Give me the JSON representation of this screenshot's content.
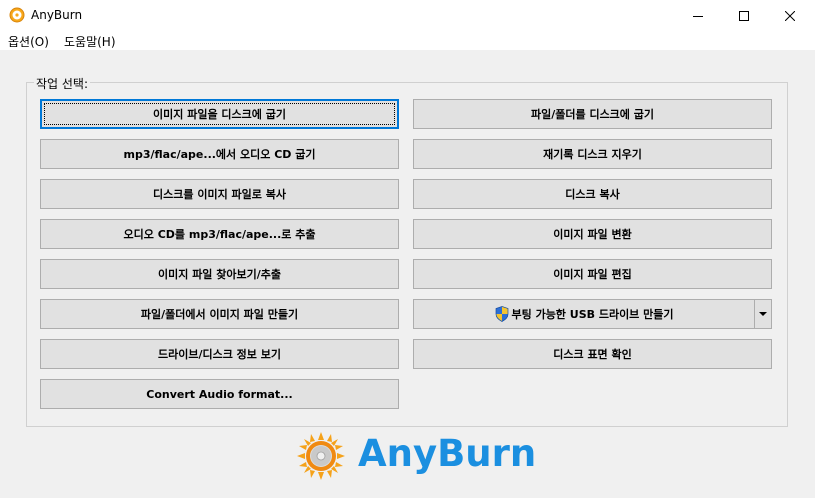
{
  "window": {
    "title": "AnyBurn"
  },
  "menu": [
    {
      "label": "옵션(O)"
    },
    {
      "label": "도움말(H)"
    }
  ],
  "group": {
    "label": "작업 선택:"
  },
  "left_buttons": [
    {
      "label": "이미지 파일을 디스크에 굽기"
    },
    {
      "label": "mp3/flac/ape...에서 오디오 CD 굽기"
    },
    {
      "label": "디스크를 이미지 파일로 복사"
    },
    {
      "label": "오디오 CD를 mp3/flac/ape...로 추출"
    },
    {
      "label": "이미지 파일 찾아보기/추출"
    },
    {
      "label": "파일/폴더에서 이미지 파일 만들기"
    },
    {
      "label": "드라이브/디스크 정보 보기"
    },
    {
      "label": "Convert Audio format..."
    }
  ],
  "right_buttons": [
    {
      "label": "파일/폴더를 디스크에 굽기"
    },
    {
      "label": "재기록 디스크 지우기"
    },
    {
      "label": "디스크 복사"
    },
    {
      "label": "이미지 파일 변환"
    },
    {
      "label": "이미지 파일 편집"
    },
    {
      "label": "부팅 가능한 USB 드라이브 만들기"
    },
    {
      "label": "디스크 표면 확인"
    }
  ],
  "logo": {
    "text": "AnyBurn"
  },
  "colors": {
    "logo_text": "#1b8fe0",
    "focus": "#0078d7",
    "button_face": "#e1e1e1"
  }
}
